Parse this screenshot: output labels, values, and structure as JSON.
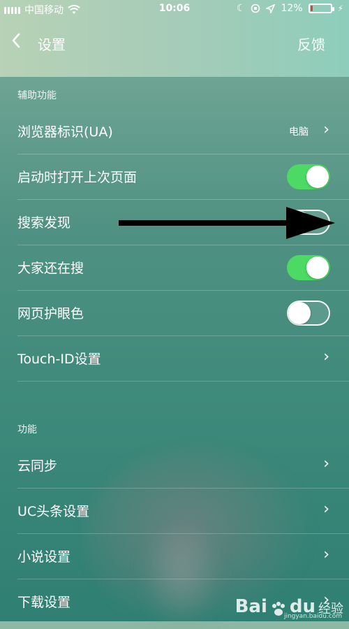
{
  "status_bar": {
    "carrier": "中国移动",
    "time": "10:06",
    "battery_percent": "12%",
    "battery_level": 0.12,
    "icons": [
      "signal-icon",
      "wifi-icon",
      "moon-icon",
      "rotation-lock-icon",
      "location-icon",
      "battery-icon",
      "charging-icon"
    ]
  },
  "nav": {
    "back_icon": "chevron-left-icon",
    "title": "设置",
    "feedback": "反馈"
  },
  "section_aux": {
    "title": "辅助功能"
  },
  "rows_aux": [
    {
      "label": "浏览器标识(UA)",
      "value": "电脑",
      "type": "link"
    },
    {
      "label": "启动时打开上次页面",
      "type": "toggle",
      "on": true
    },
    {
      "label": "搜索发现",
      "type": "toggle",
      "on": false
    },
    {
      "label": "大家还在搜",
      "type": "toggle",
      "on": true
    },
    {
      "label": "网页护眼色",
      "type": "toggle",
      "on": false
    },
    {
      "label": "Touch-ID设置",
      "type": "link"
    }
  ],
  "section_func": {
    "title": "功能"
  },
  "rows_func": [
    {
      "label": "云同步",
      "type": "link"
    },
    {
      "label": "UC头条设置",
      "type": "link"
    },
    {
      "label": "小说设置",
      "type": "link"
    },
    {
      "label": "下载设置",
      "type": "link"
    }
  ],
  "annotation": {
    "arrow_icon": "arrow-right-icon"
  },
  "watermark": {
    "brand": "Bai",
    "brand2": "du",
    "jy": "经验",
    "url": "jingyan.baidu.com"
  },
  "colors": {
    "toggle_on": "#4cd964",
    "battery_low": "#e23b3b"
  }
}
